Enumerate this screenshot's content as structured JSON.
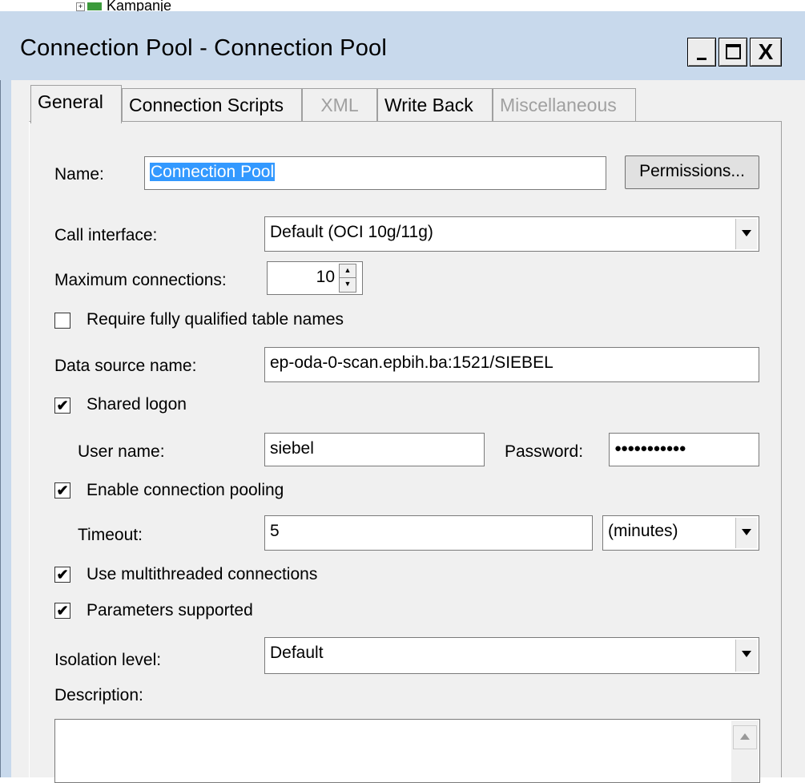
{
  "tree": {
    "label": "Kampanje"
  },
  "window": {
    "title": "Connection Pool - Connection Pool",
    "minimize": "_",
    "maximize": "□",
    "close": "X"
  },
  "tabs": [
    {
      "label": "General",
      "active": true,
      "disabled": false
    },
    {
      "label": "Connection Scripts",
      "active": false,
      "disabled": false
    },
    {
      "label": "XML",
      "active": false,
      "disabled": true
    },
    {
      "label": "Write Back",
      "active": false,
      "disabled": false
    },
    {
      "label": "Miscellaneous",
      "active": false,
      "disabled": true
    }
  ],
  "form": {
    "name_label": "Name:",
    "name_value": "Connection Pool",
    "permissions_button": "Permissions...",
    "call_interface_label": "Call interface:",
    "call_interface_value": "Default (OCI 10g/11g)",
    "max_connections_label": "Maximum connections:",
    "max_connections_value": "10",
    "require_fq_label": "Require fully qualified table names",
    "require_fq_checked": false,
    "dsn_label": "Data source name:",
    "dsn_value": "ep-oda-0-scan.epbih.ba:1521/SIEBEL",
    "shared_logon_label": "Shared logon",
    "shared_logon_checked": true,
    "user_name_label": "User name:",
    "user_name_value": "siebel",
    "password_label": "Password:",
    "password_value": "●●●●●●●●●●●",
    "conn_pooling_label": "Enable connection pooling",
    "conn_pooling_checked": true,
    "timeout_label": "Timeout:",
    "timeout_value": "5",
    "timeout_unit": "(minutes)",
    "multithreaded_label": "Use multithreaded connections",
    "multithreaded_checked": true,
    "params_supported_label": "Parameters supported",
    "params_supported_checked": true,
    "isolation_label": "Isolation level:",
    "isolation_value": "Default",
    "description_label": "Description:",
    "description_value": ""
  },
  "colors": {
    "title_bar": "#c8d9ec",
    "dialog_bg": "#f0f0f0",
    "selection": "#3399ff"
  },
  "icons": {
    "check": "✔"
  }
}
